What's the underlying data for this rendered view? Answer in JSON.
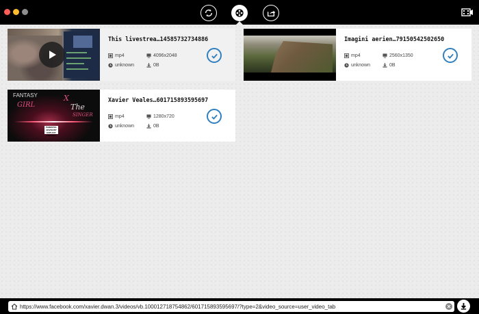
{
  "titlebar": {
    "buttons": [
      {
        "name": "refresh-icon",
        "active": false
      },
      {
        "name": "film-reel-icon",
        "active": true
      },
      {
        "name": "share-icon",
        "active": false
      }
    ],
    "menu_icon": "film-menu-icon"
  },
  "videos": [
    {
      "title": "This livestrea…14585732734886",
      "format": "mp4",
      "resolution": "4096x2048",
      "duration": "unknown",
      "size": "0B",
      "selected": true
    },
    {
      "title": "Imagini aerien…79150542502650",
      "format": "mp4",
      "resolution": "2560x1350",
      "duration": "unknown",
      "size": "0B",
      "selected": true
    },
    {
      "title": "Xavier Veales…601715893595697",
      "format": "mp4",
      "resolution": "1280x720",
      "duration": "unknown",
      "size": "0B",
      "selected": true,
      "thumb_text": {
        "fantasy": "FANTASY",
        "girl": "GIRL",
        "x": "X",
        "the": "The",
        "singer": "SINGER",
        "advisory": "PARENTAL ADVISORY EXPLICIT CONTENT"
      }
    }
  ],
  "urlbar": {
    "value": "https://www.facebook.com/xavier.dwan.3/videos/vb.100012718754862/601715893595697/?type=2&video_source=user_video_tab"
  },
  "colors": {
    "accent": "#2f7fbf",
    "titlebar": "#000000",
    "background": "#ececec"
  }
}
